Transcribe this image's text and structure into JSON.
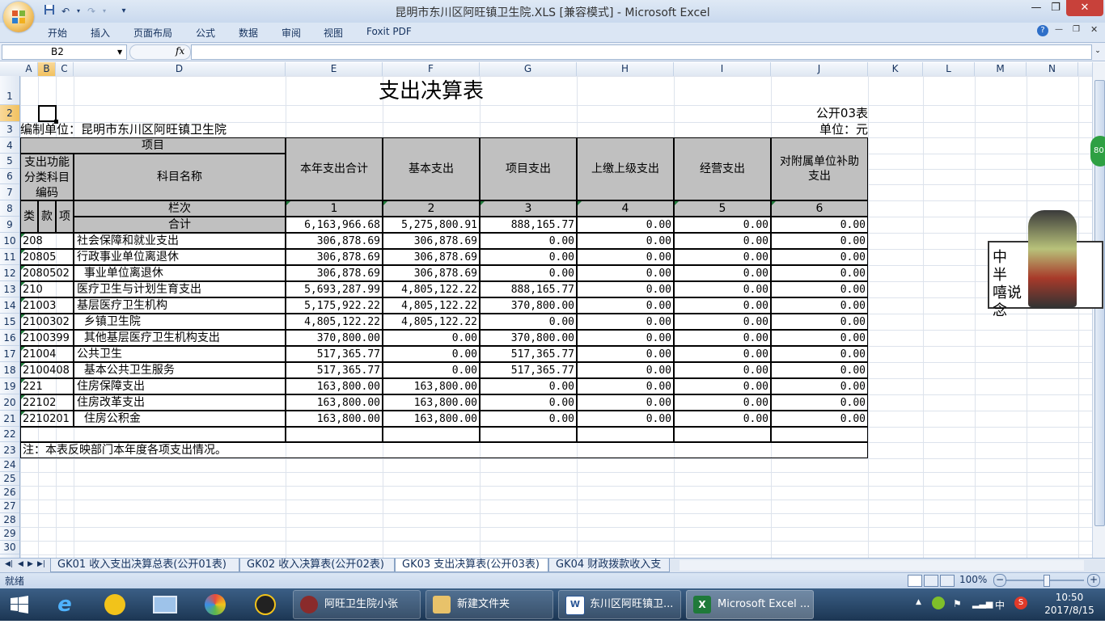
{
  "window": {
    "title": "昆明市东川区阿旺镇卫生院.XLS  [兼容模式] - Microsoft Excel"
  },
  "ribbon": {
    "tabs": [
      "开始",
      "插入",
      "页面布局",
      "公式",
      "数据",
      "审阅",
      "视图",
      "Foxit PDF"
    ]
  },
  "formula_bar": {
    "name_box": "B2",
    "fx": "fx",
    "value": ""
  },
  "columns": [
    "A",
    "B",
    "C",
    "D",
    "E",
    "F",
    "G",
    "H",
    "I",
    "J",
    "K",
    "L",
    "M",
    "N"
  ],
  "rows": [
    "1",
    "2",
    "3",
    "4",
    "5",
    "6",
    "7",
    "8",
    "9",
    "10",
    "11",
    "12",
    "13",
    "14",
    "15",
    "16",
    "17",
    "18",
    "19",
    "20",
    "21",
    "22",
    "23",
    "24",
    "25",
    "26",
    "27",
    "28",
    "29",
    "30"
  ],
  "sheet": {
    "title": "支出决算表",
    "form_code": "公开03表",
    "org_label": "编制单位：昆明市东川区阿旺镇卫生院",
    "unit_label": "单位：元",
    "header": {
      "item": "项目",
      "func_code": "支出功能分类科目编码",
      "subject_name": "科目名称",
      "lei": "类",
      "kuan": "款",
      "xiang": "项",
      "column_index_label": "栏次",
      "total_label": "合计",
      "cols": [
        {
          "name": "本年支出合计",
          "idx": "1"
        },
        {
          "name": "基本支出",
          "idx": "2"
        },
        {
          "name": "项目支出",
          "idx": "3"
        },
        {
          "name": "上缴上级支出",
          "idx": "4"
        },
        {
          "name": "经营支出",
          "idx": "5"
        },
        {
          "name": "对附属单位补助支出",
          "idx": "6"
        }
      ]
    },
    "total_row": [
      "6,163,966.68",
      "5,275,800.91",
      "888,165.77",
      "0.00",
      "0.00",
      "0.00"
    ],
    "rows": [
      {
        "code": "208",
        "name": "社会保障和就业支出",
        "v": [
          "306,878.69",
          "306,878.69",
          "0.00",
          "0.00",
          "0.00",
          "0.00"
        ]
      },
      {
        "code": "20805",
        "name": "行政事业单位离退休",
        "v": [
          "306,878.69",
          "306,878.69",
          "0.00",
          "0.00",
          "0.00",
          "0.00"
        ]
      },
      {
        "code": "2080502",
        "name": "  事业单位离退休",
        "v": [
          "306,878.69",
          "306,878.69",
          "0.00",
          "0.00",
          "0.00",
          "0.00"
        ]
      },
      {
        "code": "210",
        "name": "医疗卫生与计划生育支出",
        "v": [
          "5,693,287.99",
          "4,805,122.22",
          "888,165.77",
          "0.00",
          "0.00",
          "0.00"
        ]
      },
      {
        "code": "21003",
        "name": "基层医疗卫生机构",
        "v": [
          "5,175,922.22",
          "4,805,122.22",
          "370,800.00",
          "0.00",
          "0.00",
          "0.00"
        ]
      },
      {
        "code": "2100302",
        "name": "  乡镇卫生院",
        "v": [
          "4,805,122.22",
          "4,805,122.22",
          "0.00",
          "0.00",
          "0.00",
          "0.00"
        ]
      },
      {
        "code": "2100399",
        "name": "  其他基层医疗卫生机构支出",
        "v": [
          "370,800.00",
          "0.00",
          "370,800.00",
          "0.00",
          "0.00",
          "0.00"
        ]
      },
      {
        "code": "21004",
        "name": "公共卫生",
        "v": [
          "517,365.77",
          "0.00",
          "517,365.77",
          "0.00",
          "0.00",
          "0.00"
        ]
      },
      {
        "code": "2100408",
        "name": "  基本公共卫生服务",
        "v": [
          "517,365.77",
          "0.00",
          "517,365.77",
          "0.00",
          "0.00",
          "0.00"
        ]
      },
      {
        "code": "221",
        "name": "住房保障支出",
        "v": [
          "163,800.00",
          "163,800.00",
          "0.00",
          "0.00",
          "0.00",
          "0.00"
        ]
      },
      {
        "code": "22102",
        "name": "住房改革支出",
        "v": [
          "163,800.00",
          "163,800.00",
          "0.00",
          "0.00",
          "0.00",
          "0.00"
        ]
      },
      {
        "code": "2210201",
        "name": "  住房公积金",
        "v": [
          "163,800.00",
          "163,800.00",
          "0.00",
          "0.00",
          "0.00",
          "0.00"
        ]
      }
    ],
    "note": "注：本表反映部门本年度各项支出情况。"
  },
  "sheet_tabs": [
    {
      "label": "GK01 收入支出决算总表(公开01表)",
      "active": false
    },
    {
      "label": "GK02 收入决算表(公开02表)",
      "active": false
    },
    {
      "label": "GK03 支出决算表(公开03表)",
      "active": true
    },
    {
      "label": "GK04 财政拨款收入支",
      "active": false
    }
  ],
  "status": {
    "text": "就绪",
    "zoom": "100%"
  },
  "taskbar": {
    "tasks": [
      {
        "label": "阿旺卫生院小张",
        "icon": "user-avatar-icon",
        "active": false
      },
      {
        "label": "新建文件夹",
        "icon": "folder-icon",
        "active": false
      },
      {
        "label": "东川区阿旺镇卫...",
        "icon": "word-doc-icon",
        "active": false
      },
      {
        "label": "Microsoft Excel ...",
        "icon": "excel-icon",
        "active": true
      }
    ],
    "ime": "中",
    "time": "10:50",
    "date": "2017/8/15"
  },
  "widget": {
    "badge": "80",
    "caption": "中 半 嘻说念"
  },
  "colors": {
    "header_fill": "#c0c0c0",
    "selection": "#f1c15f",
    "taskbar": "#1c3653"
  }
}
